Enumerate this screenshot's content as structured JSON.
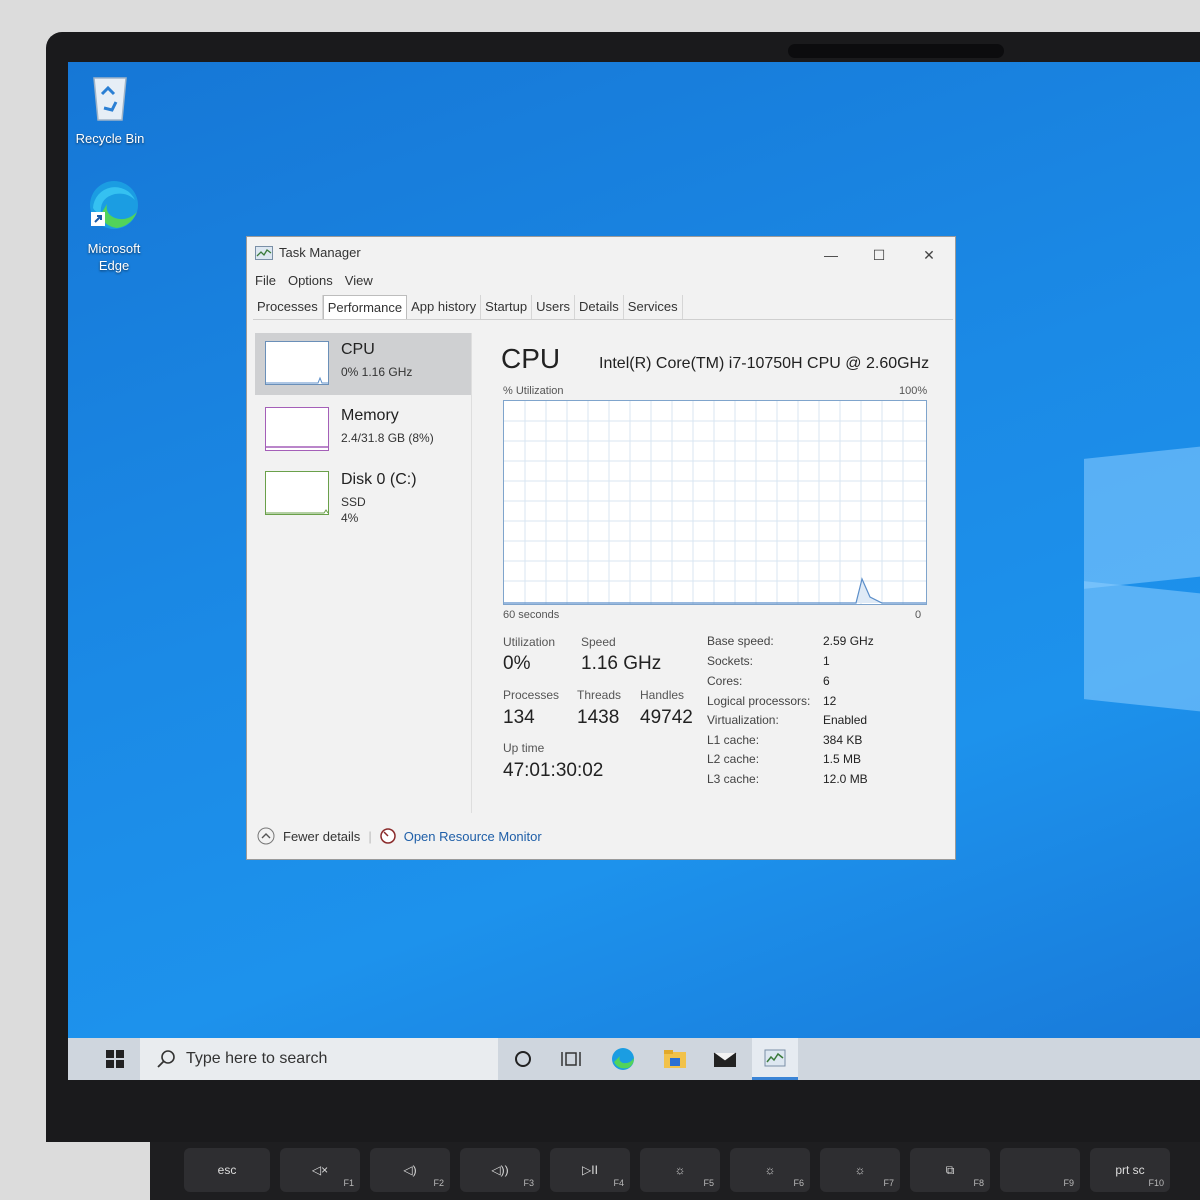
{
  "desktop": {
    "icons": [
      {
        "label": "Recycle Bin"
      },
      {
        "label": "Microsoft Edge"
      }
    ]
  },
  "task_manager": {
    "title": "Task Manager",
    "menu": [
      "File",
      "Options",
      "View"
    ],
    "tabs": [
      "Processes",
      "Performance",
      "App history",
      "Startup",
      "Users",
      "Details",
      "Services"
    ],
    "active_tab": "Performance",
    "resources": [
      {
        "name": "CPU",
        "line1": "0% 1.16 GHz",
        "line2": ""
      },
      {
        "name": "Memory",
        "line1": "2.4/31.8 GB (8%)",
        "line2": ""
      },
      {
        "name": "Disk 0 (C:)",
        "line1": "SSD",
        "line2": "4%"
      }
    ],
    "cpu_title": "CPU",
    "cpu_model": "Intel(R) Core(TM) i7-10750H CPU @ 2.60GHz",
    "graph_label_tl": "% Utilization",
    "graph_label_tr": "100%",
    "graph_label_bl": "60 seconds",
    "graph_label_br": "0",
    "stats": {
      "utilization_label": "Utilization",
      "utilization": "0%",
      "speed_label": "Speed",
      "speed": "1.16 GHz",
      "processes_label": "Processes",
      "processes": "134",
      "threads_label": "Threads",
      "threads": "1438",
      "handles_label": "Handles",
      "handles": "49742",
      "uptime_label": "Up time",
      "uptime": "47:01:30:02"
    },
    "specs": [
      {
        "k": "Base speed:",
        "v": "2.59 GHz"
      },
      {
        "k": "Sockets:",
        "v": "1"
      },
      {
        "k": "Cores:",
        "v": "6"
      },
      {
        "k": "Logical processors:",
        "v": "12"
      },
      {
        "k": "Virtualization:",
        "v": "Enabled"
      },
      {
        "k": "L1 cache:",
        "v": "384 KB"
      },
      {
        "k": "L2 cache:",
        "v": "1.5 MB"
      },
      {
        "k": "L3 cache:",
        "v": "12.0 MB"
      }
    ],
    "fewer_details": "Fewer details",
    "open_resource_monitor": "Open Resource Monitor"
  },
  "taskbar": {
    "search_placeholder": "Type here to search"
  },
  "keyboard": {
    "keys": [
      {
        "label": "esc",
        "fn": ""
      },
      {
        "label": "◁×",
        "fn": "F1"
      },
      {
        "label": "◁)",
        "fn": "F2"
      },
      {
        "label": "◁))",
        "fn": "F3"
      },
      {
        "label": "▷II",
        "fn": "F4"
      },
      {
        "label": "☼",
        "fn": "F5"
      },
      {
        "label": "☼",
        "fn": "F6"
      },
      {
        "label": "☼",
        "fn": "F7"
      },
      {
        "label": "⧉",
        "fn": "F8"
      },
      {
        "label": "",
        "fn": "F9"
      },
      {
        "label": "prt sc",
        "fn": "F10"
      }
    ]
  },
  "colors": {
    "desktop_blue": "#1b8ae6",
    "taskbar": "#cfd6de",
    "graph_line": "#5b8ec9",
    "link": "#1f5fa8"
  }
}
